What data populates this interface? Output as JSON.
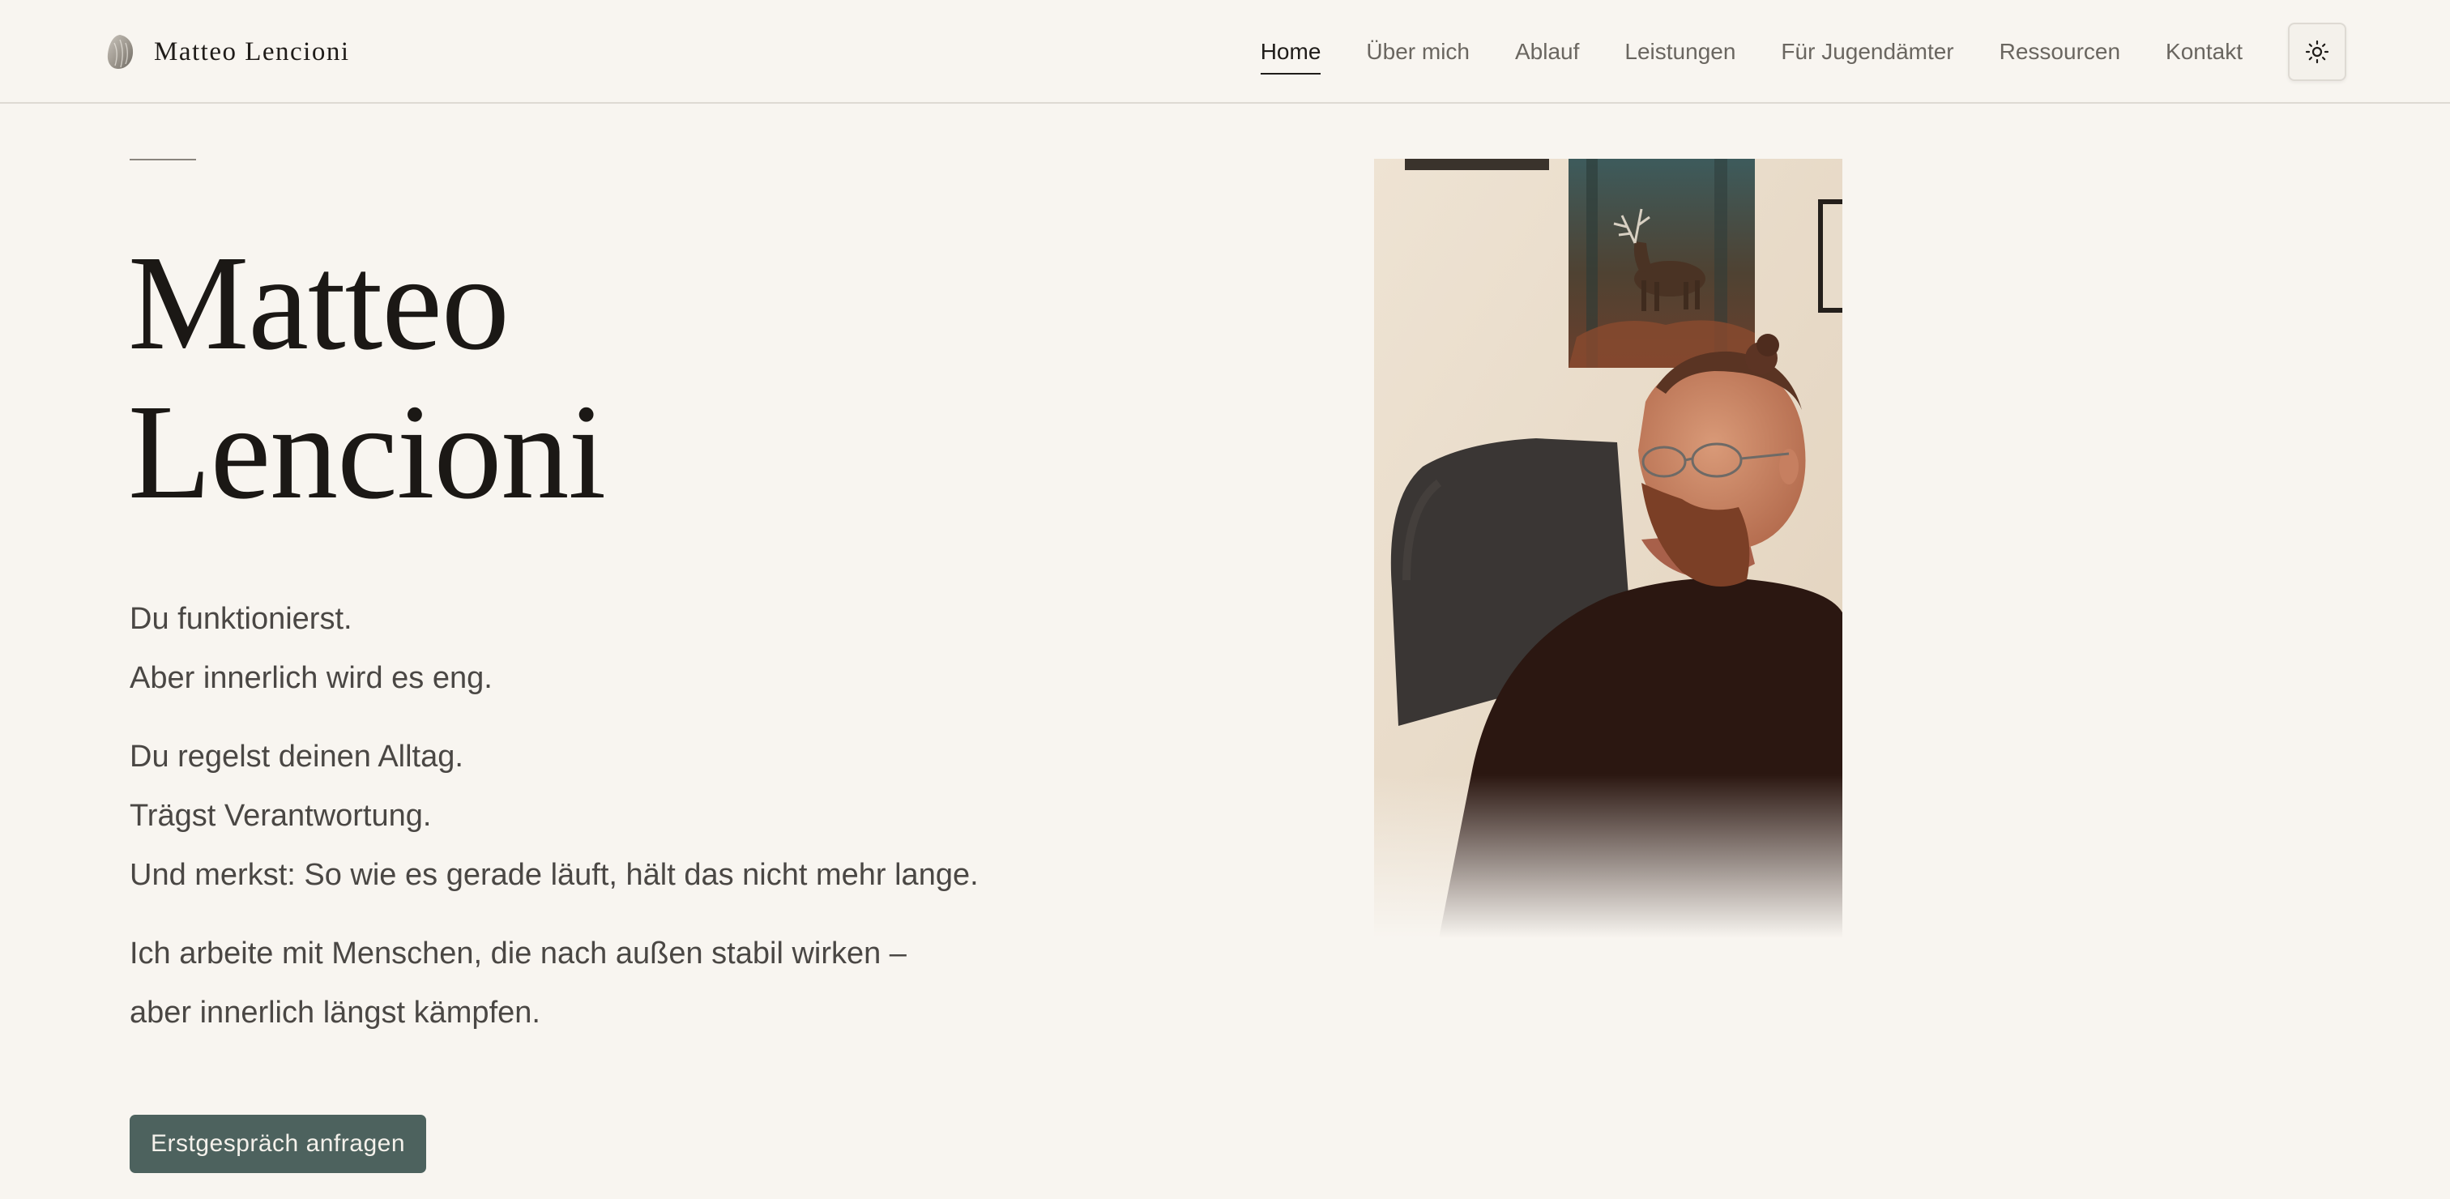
{
  "brand": {
    "name": "Matteo Lencioni",
    "logo_icon": "stone-leaf-logo-icon"
  },
  "nav": {
    "items": [
      {
        "label": "Home",
        "active": true
      },
      {
        "label": "Über mich",
        "active": false
      },
      {
        "label": "Ablauf",
        "active": false
      },
      {
        "label": "Leistungen",
        "active": false
      },
      {
        "label": "Für Jugendämter",
        "active": false
      },
      {
        "label": "Ressourcen",
        "active": false
      },
      {
        "label": "Kontakt",
        "active": false
      }
    ],
    "theme_toggle_icon": "sun-icon"
  },
  "hero": {
    "title_line1": "Matteo",
    "title_line2": "Lencioni",
    "paragraphs": [
      [
        "Du funktionierst.",
        "Aber innerlich wird es eng."
      ],
      [
        "Du regelst deinen Alltag.",
        "Trägst Verantwortung.",
        "Und merkst: So wie es gerade läuft, hält das nicht mehr lange."
      ],
      [
        "Ich arbeite mit Menschen, die nach außen stabil wirken –",
        "aber innerlich längst kämpfen."
      ]
    ],
    "cta_label": "Erstgespräch anfragen",
    "portrait_image": "portrait-photo"
  },
  "colors": {
    "background": "#f8f5f0",
    "text": "#4a4744",
    "heading": "#1b1815",
    "button": "#4d625e",
    "border": "#dedad3"
  }
}
